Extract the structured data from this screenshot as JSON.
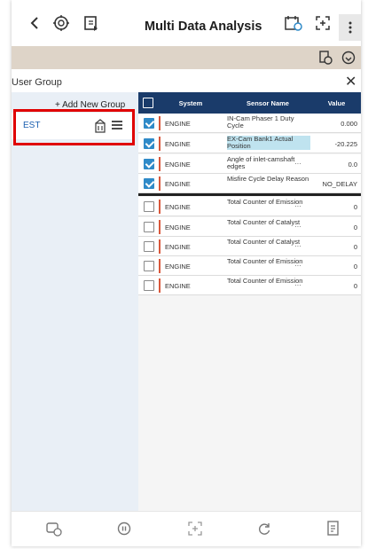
{
  "header": {
    "title": "Multi Data Analysis"
  },
  "user_group": {
    "label": "User Group",
    "add_label": "+ Add New Group",
    "groups": [
      {
        "name": "EST"
      }
    ]
  },
  "table": {
    "columns": [
      "System",
      "Sensor Name",
      "Value"
    ],
    "rows": [
      {
        "checked": true,
        "system": "ENGINE",
        "sensor": "IN-Cam Phaser 1 Duty Cycle",
        "value": "0.000",
        "more": false,
        "highlight": false
      },
      {
        "checked": true,
        "system": "ENGINE",
        "sensor": "EX-Cam Bank1 Actual Position",
        "value": "-20.225",
        "more": false,
        "highlight": true
      },
      {
        "checked": true,
        "system": "ENGINE",
        "sensor": "Angle of inlet-camshaft edges",
        "value": "0.0",
        "more": true,
        "highlight": false
      },
      {
        "checked": true,
        "system": "ENGINE",
        "sensor": "Misfire Cycle Delay Reason",
        "value": "NO_DELAY",
        "more": false,
        "highlight": false
      },
      {
        "checked": false,
        "system": "ENGINE",
        "sensor": "Total Counter of Emission",
        "value": "0",
        "more": true,
        "highlight": false
      },
      {
        "checked": false,
        "system": "ENGINE",
        "sensor": "Total Counter of Catalyst",
        "value": "0",
        "more": true,
        "highlight": false
      },
      {
        "checked": false,
        "system": "ENGINE",
        "sensor": "Total Counter of Catalyst",
        "value": "0",
        "more": true,
        "highlight": false
      },
      {
        "checked": false,
        "system": "ENGINE",
        "sensor": "Total Counter of Emission",
        "value": "0",
        "more": true,
        "highlight": false
      },
      {
        "checked": false,
        "system": "ENGINE",
        "sensor": "Total Counter of Emission",
        "value": "0",
        "more": true,
        "highlight": false
      }
    ]
  },
  "colors": {
    "header_bg": "#1a3b6a",
    "toolbar_bg": "#ded4c8",
    "panel_bg": "#e9eff6",
    "checkbox": "#2f8ac8",
    "highlight_box": "#e00000",
    "system_bar": "#d9583b"
  },
  "icons": [
    "back-icon",
    "vci-icon",
    "export-icon",
    "calendar-icon",
    "expand-icon",
    "more-vertical-icon",
    "record-icon",
    "settings-circle-icon",
    "close-icon",
    "edit-group-icon",
    "menu-icon",
    "vehicle-icon",
    "pause-icon",
    "fullscreen-icon",
    "refresh-icon",
    "report-icon"
  ]
}
